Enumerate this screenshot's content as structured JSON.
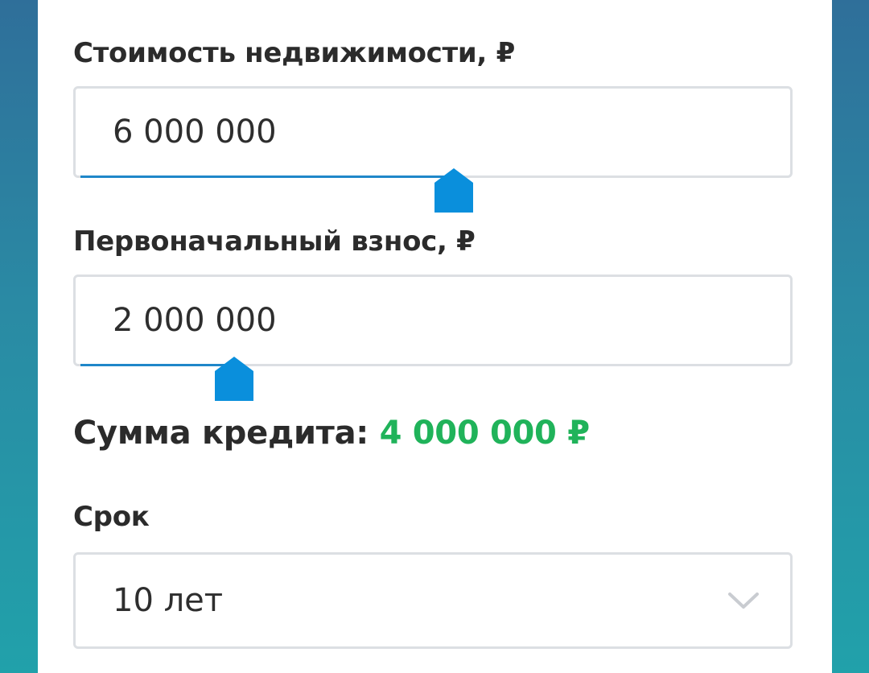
{
  "property_cost": {
    "label": "Стоимость недвижимости, ₽",
    "value": "6 000 000",
    "slider_fraction": 0.53
  },
  "down_payment": {
    "label": "Первоначальный взнос, ₽",
    "value": "2 000 000",
    "slider_fraction": 0.22
  },
  "loan": {
    "label": "Сумма кредита:",
    "amount": "4 000 000 ₽"
  },
  "term": {
    "label": "Срок",
    "selected": "10 лет"
  },
  "colors": {
    "accent": "#1f87c9",
    "thumb": "#0a8fdc",
    "amount": "#20b35a",
    "background_top": "#2f6f9a",
    "background_bottom": "#21a1aa"
  },
  "icons": {
    "slider_thumb": "house-shaped-thumb",
    "select_arrow": "chevron-down-icon"
  }
}
